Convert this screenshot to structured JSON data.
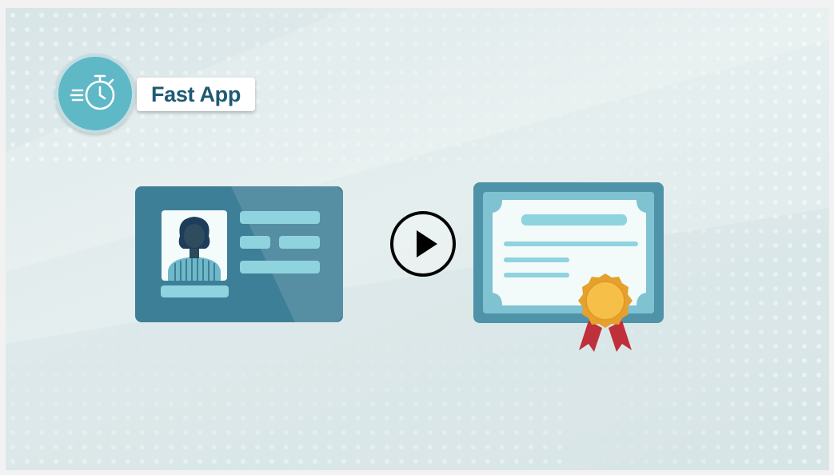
{
  "badge": {
    "label": "Fast App",
    "icon": "stopwatch-icon"
  },
  "video": {
    "play_icon": "play-icon"
  },
  "illustration": {
    "id_card_icon": "id-card-icon",
    "certificate_icon": "certificate-icon",
    "colors": {
      "card_dark": "#3d7f97",
      "card_light": "#5fa2b5",
      "bar": "#8fd3df",
      "cert_frame": "#4f93a9",
      "cert_paper": "#f2fafa",
      "seal": "#f0b43c",
      "ribbon": "#c0303a"
    }
  }
}
